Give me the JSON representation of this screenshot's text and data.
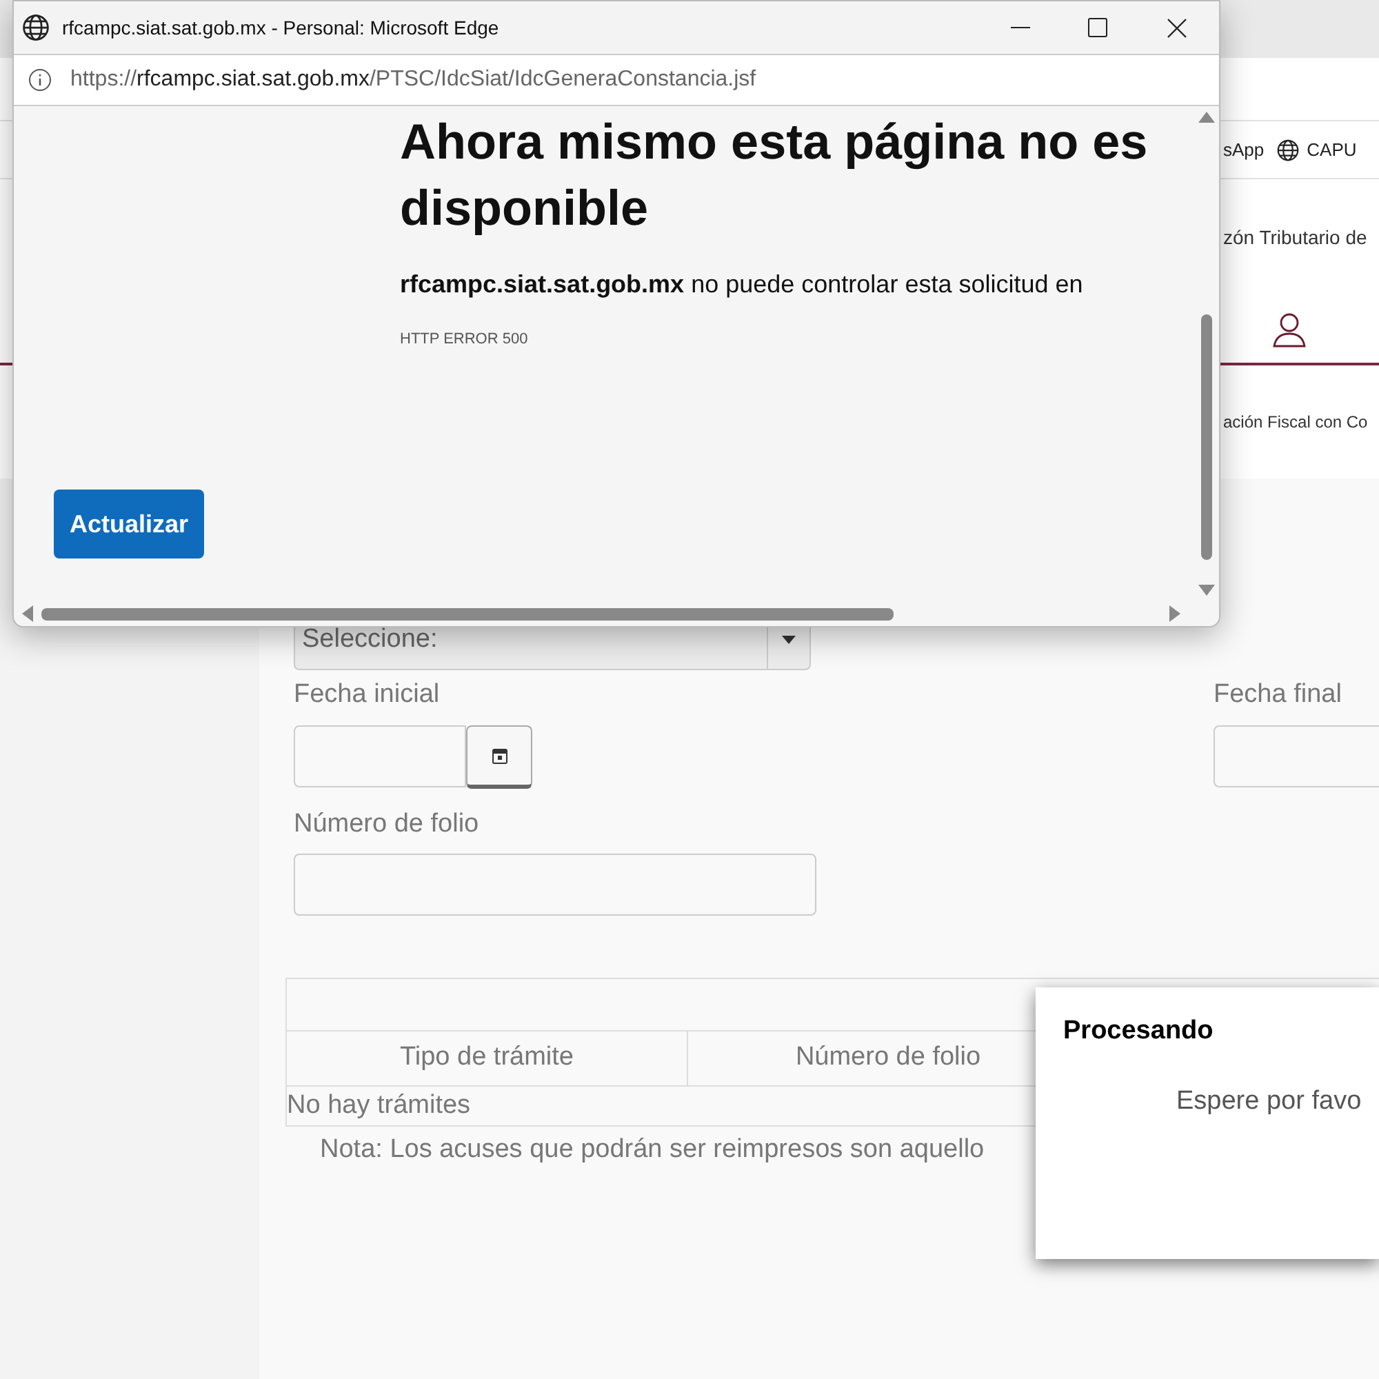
{
  "browser": {
    "bookmarks": [
      {
        "label": "sApp",
        "kind": "plain"
      },
      {
        "label": "CAPU",
        "kind": "globe"
      }
    ]
  },
  "site": {
    "header_text": "zón Tributario de",
    "breadcrumb": "ación Fiscal con Co"
  },
  "form": {
    "select": {
      "placeholder": "Seleccione:"
    },
    "start_date": {
      "label": "Fecha inicial"
    },
    "end_date": {
      "label": "Fecha final"
    },
    "folio": {
      "label": "Número de folio"
    }
  },
  "table": {
    "columns": [
      "Tipo de trámite",
      "Número de folio"
    ],
    "empty_message": "No hay trámites"
  },
  "note": "Nota: Los acuses que podrán ser reimpresos son aquello",
  "dialog": {
    "title": "Procesando",
    "message": "Espere por favo"
  },
  "popup": {
    "title": "rfcampc.siat.sat.gob.mx - Personal: Microsoft Edge",
    "url": {
      "scheme": "https://",
      "host": "rfcampc.siat.sat.gob.mx",
      "path": "/PTSC/IdcSiat/IdcGeneraConstancia.jsf"
    },
    "heading": [
      "Ahora mismo esta página no es",
      "disponible"
    ],
    "message": "**rfcampc.siat.sat.gob.mx** no puede controlar esta solicitud en",
    "error_code": "HTTP ERROR 500",
    "button": "Actualizar"
  }
}
